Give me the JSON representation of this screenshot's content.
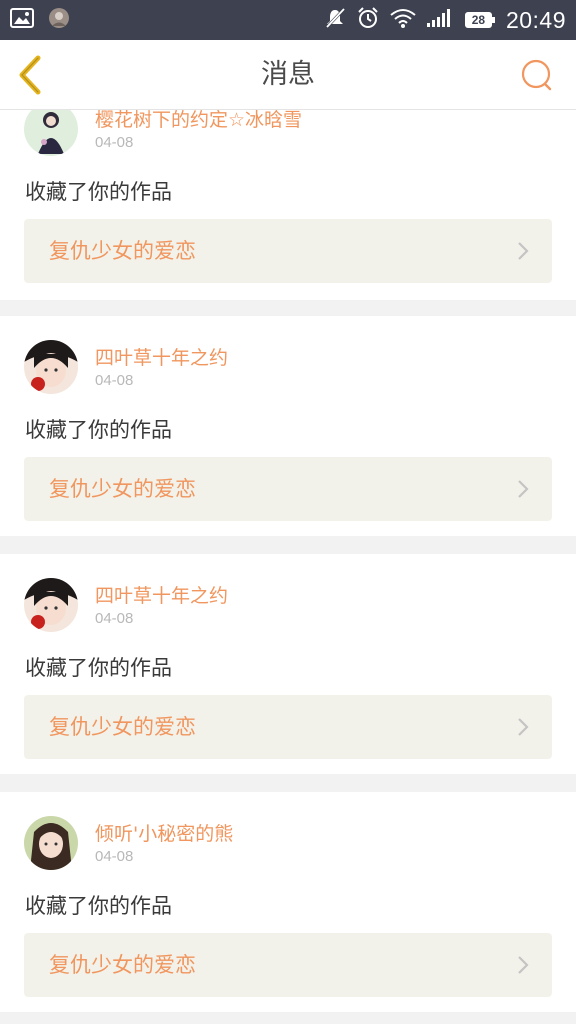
{
  "status_bar": {
    "time": "20:49",
    "battery": "28",
    "icons": [
      "image-icon",
      "app-thumbnail-icon",
      "notifications-muted-icon",
      "alarm-icon",
      "wifi-icon",
      "signal-icon",
      "battery-icon"
    ]
  },
  "header": {
    "title": "消息",
    "back_icon": "chevron-left-icon",
    "search_icon": "search-icon"
  },
  "colors": {
    "accent": "#f0965e",
    "back_arrow": "#e5b41d",
    "status_bar": "#3d4150",
    "work_box": "#f3f2ea"
  },
  "messages": [
    {
      "user": "樱花树下的约定☆冰晗雪",
      "date": "04-08",
      "action": "收藏了你的作品",
      "work": "复仇少女的爱恋"
    },
    {
      "user": "四叶草十年之约",
      "date": "04-08",
      "action": "收藏了你的作品",
      "work": "复仇少女的爱恋"
    },
    {
      "user": "四叶草十年之约",
      "date": "04-08",
      "action": "收藏了你的作品",
      "work": "复仇少女的爱恋"
    },
    {
      "user": "倾听'小秘密的熊",
      "date": "04-08",
      "action": "收藏了你的作品",
      "work": "复仇少女的爱恋"
    }
  ]
}
